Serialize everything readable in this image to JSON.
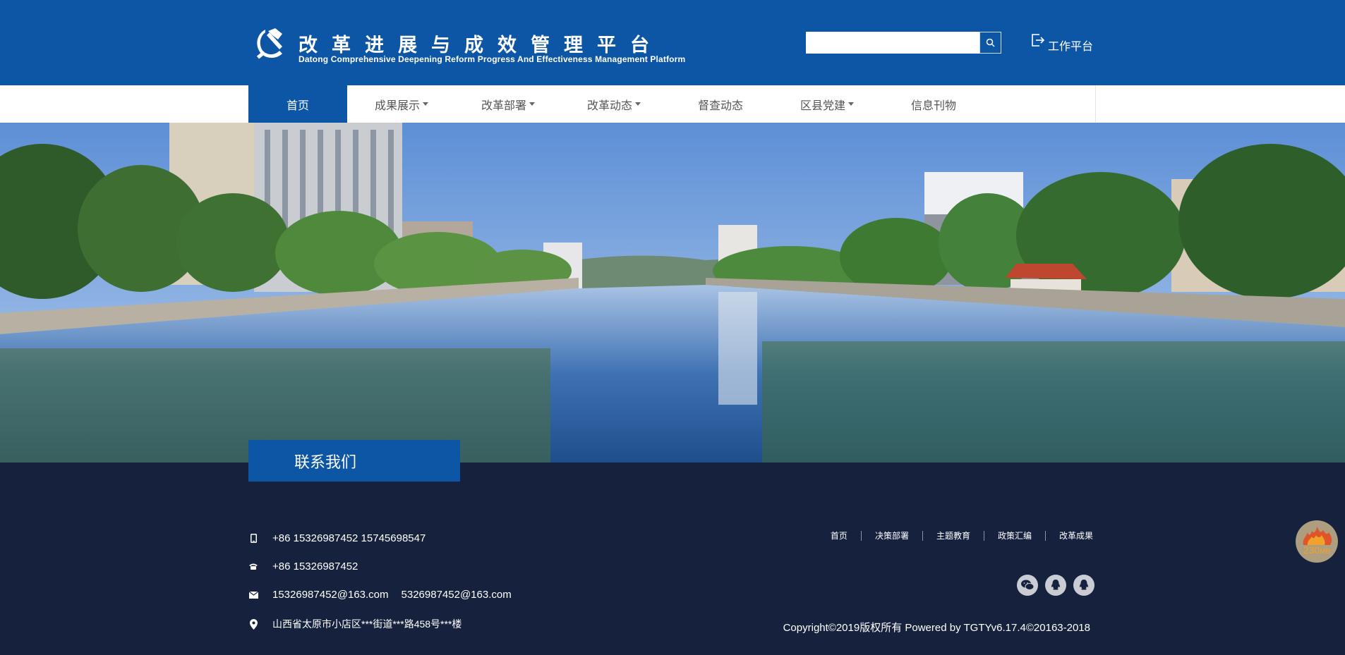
{
  "header": {
    "title": "改革进展与成效管理平台",
    "subtitle": "Datong Comprehensive Deepening Reform Progress And Effectiveness Management Platform",
    "search": {
      "placeholder": "",
      "value": ""
    },
    "search_icon": "search-icon",
    "workbench_label": "工作平台",
    "workbench_icon": "exit-icon",
    "brand_color": "#0d56a6"
  },
  "nav": {
    "items": [
      {
        "label": "首页",
        "active": true,
        "dropdown": false
      },
      {
        "label": "成果展示",
        "active": false,
        "dropdown": true
      },
      {
        "label": "改革部署",
        "active": false,
        "dropdown": true
      },
      {
        "label": "改革动态",
        "active": false,
        "dropdown": true
      },
      {
        "label": "督查动态",
        "active": false,
        "dropdown": false
      },
      {
        "label": "区县党建",
        "active": false,
        "dropdown": true
      },
      {
        "label": "信息刊物",
        "active": false,
        "dropdown": false
      }
    ]
  },
  "contact": {
    "title": "联系我们",
    "mobile": "+86 15326987452 15745698547",
    "phone": "+86 15326987452",
    "email_1": "15326987452@163.com",
    "email_2": "5326987452@163.com",
    "address": "山西省太原市小店区***街道***路458号***楼",
    "icons": [
      "mobile-icon",
      "phone-icon",
      "mail-icon",
      "location-icon"
    ]
  },
  "footer": {
    "links": [
      "首页",
      "决策部署",
      "主题教育",
      "政策汇编",
      "改革成果"
    ],
    "social": [
      "wechat-icon",
      "qq-icon",
      "qq-icon"
    ],
    "copyright": "Copyright©2019版权所有 Powered by TGTYv6.17.4©20163-2018",
    "background_color": "#15213d"
  },
  "memory_widget": {
    "value": "230",
    "unit": "MB",
    "icon": "flame-icon"
  }
}
